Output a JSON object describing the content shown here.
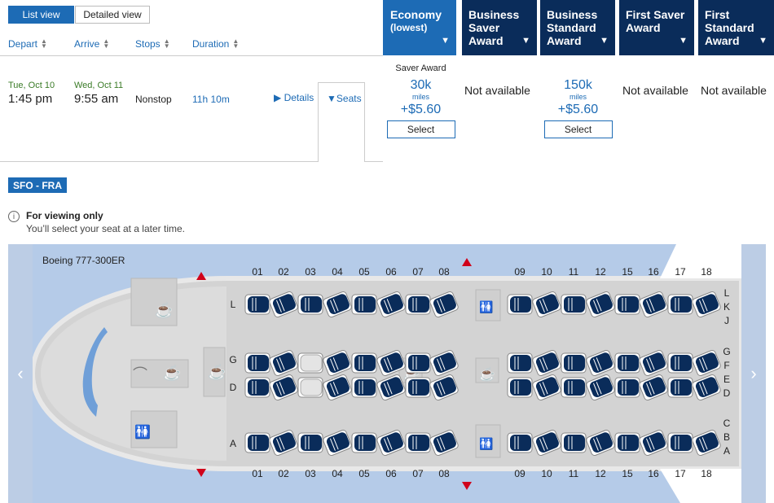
{
  "views": {
    "list": "List view",
    "detailed": "Detailed view"
  },
  "columns": {
    "depart": "Depart",
    "arrive": "Arrive",
    "stops": "Stops",
    "duration": "Duration"
  },
  "fare_tabs": [
    {
      "line1": "Economy",
      "line2": "(lowest)",
      "line3": ""
    },
    {
      "line1": "Business",
      "line2": "Saver",
      "line3": "Award"
    },
    {
      "line1": "Business",
      "line2": "Standard",
      "line3": "Award"
    },
    {
      "line1": "First Saver",
      "line2": "Award",
      "line3": ""
    },
    {
      "line1": "First",
      "line2": "Standard",
      "line3": "Award"
    }
  ],
  "flight": {
    "depart_date": "Tue, Oct 10",
    "depart_time": "1:45 pm",
    "arrive_date": "Wed, Oct 11",
    "arrive_time": "9:55 am",
    "stops": "Nonstop",
    "duration": "11h 10m",
    "details": "Details",
    "seats": "Seats"
  },
  "fares": {
    "economy": {
      "label": "Saver Award",
      "miles": "30k",
      "unit": "miles",
      "tax": "+$5.60",
      "select": "Select"
    },
    "business_saver": "Not available",
    "business_standard": {
      "miles": "150k",
      "unit": "miles",
      "tax": "+$5.60",
      "select": "Select"
    },
    "first_saver": "Not available",
    "first_standard": "Not available"
  },
  "route": "SFO - FRA",
  "notice": {
    "title": "For viewing only",
    "subtitle": "You’ll select your seat at a later time."
  },
  "seatmap": {
    "aircraft": "Boeing 777-300ER",
    "rows_front": [
      "01",
      "02",
      "03",
      "04",
      "05",
      "06",
      "07",
      "08"
    ],
    "rows_rear": [
      "09",
      "10",
      "11",
      "12",
      "15",
      "16",
      "17",
      "18"
    ],
    "seat_letters_left": [
      "L",
      "G",
      "D",
      "A"
    ],
    "seat_letters_right": [
      "L",
      "K",
      "J",
      "G",
      "F",
      "E",
      "D",
      "C",
      "B",
      "A"
    ],
    "seat_color": "#0a2c5a",
    "blocked_seats": [
      "G-03",
      "D-03"
    ]
  },
  "nav": {
    "prev": "‹",
    "next": "›"
  },
  "colors": {
    "brand": "#1d6bb5",
    "dark": "#0a2c5a",
    "green": "#3a7b27"
  }
}
